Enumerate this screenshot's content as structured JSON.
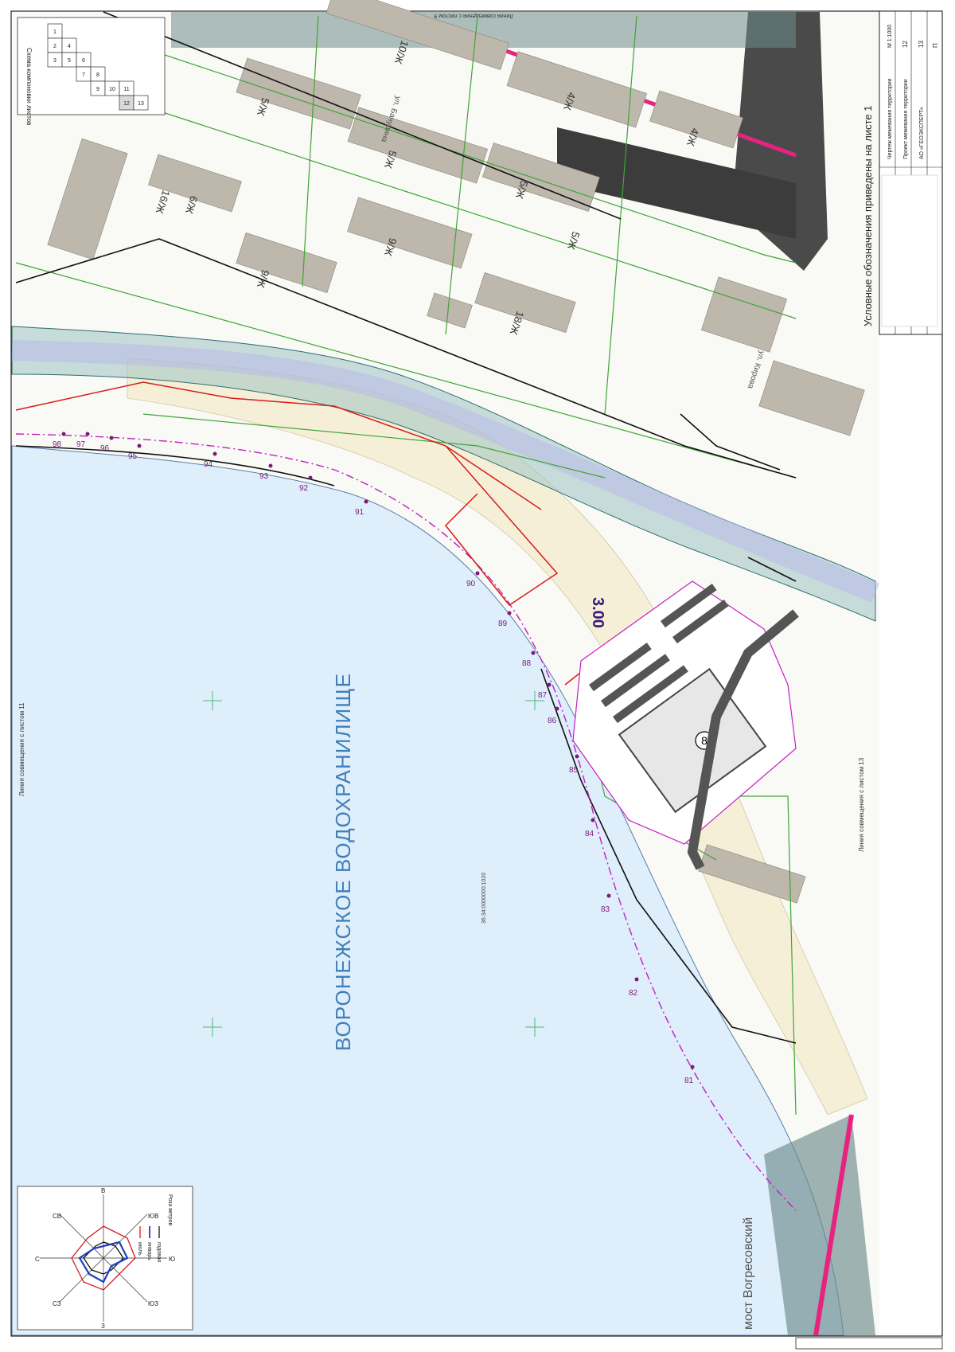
{
  "map": {
    "water_body": "ВОРОНЕЖСКОЕ ВОДОХРАНИЛИЩЕ",
    "bridge_label": "мост Вогресовский",
    "area_label": "3.00",
    "parcel_number": "8",
    "cadastral": {
      "water": "36:34:0000000:1020"
    }
  },
  "notes": {
    "legend_ref": "Условные обозначения приведены на листе 1",
    "sheet_left_join": "Линия совмещения с листом 11",
    "sheet_bottom_join": "Линия совмещения с листом 13",
    "sheet_top_join": "Линия совмещения с листом 9"
  },
  "key_plan": {
    "title": "Схема компоновки листов",
    "cells": [
      "1",
      "2",
      "3",
      "4",
      "5",
      "6",
      "7",
      "8",
      "9",
      "10",
      "11",
      "12",
      "13"
    ]
  },
  "wind_rose": {
    "title": "Роза ветров",
    "directions": [
      "С",
      "СВ",
      "В",
      "ЮВ",
      "Ю",
      "ЮЗ",
      "З",
      "СЗ"
    ],
    "legend": [
      "годовая",
      "январь",
      "июль"
    ],
    "colors": {
      "annual": "#000000",
      "january": "#1f3fbf",
      "july": "#d11f1f"
    }
  },
  "buildings": [
    {
      "label": "5/Ж"
    },
    {
      "label": "5/Ж"
    },
    {
      "label": "5/Ж"
    },
    {
      "label": "5/Ж"
    },
    {
      "label": "9/Ж"
    },
    {
      "label": "9/Ж"
    },
    {
      "label": "10/Ж"
    },
    {
      "label": "16/Ж"
    },
    {
      "label": "4/Ж"
    },
    {
      "label": "4/Ж"
    },
    {
      "label": "18/Ж"
    },
    {
      "label": "6/Ж"
    }
  ],
  "streets": [
    "ул. Бачурина",
    "ул. Кирова"
  ],
  "survey_points": [
    "81",
    "82",
    "83",
    "84",
    "85",
    "86",
    "87",
    "88",
    "89",
    "90",
    "91",
    "92",
    "93",
    "94",
    "95",
    "96",
    "97",
    "98"
  ],
  "title_block": {
    "stage": "П",
    "sheet": "12",
    "sheets": "13",
    "scale": "М 1:1000",
    "drawing_title": "Чертеж межевания территории",
    "project": "Проект межевания территории",
    "org": "АО «ГЕОЭКСПЕРТ»"
  },
  "colors": {
    "water": "#dfeefb",
    "beach": "#f5efd8",
    "land": "#ffffff",
    "parcel_green": "#3fa535",
    "boundary_magenta": "#c21fc2",
    "red_line": "#d81c1c",
    "teal_zone": "#7fa8a8",
    "road_dark": "#3c3c3c",
    "building": "#bdb7ac",
    "highlight_pink": "#e6237e"
  }
}
